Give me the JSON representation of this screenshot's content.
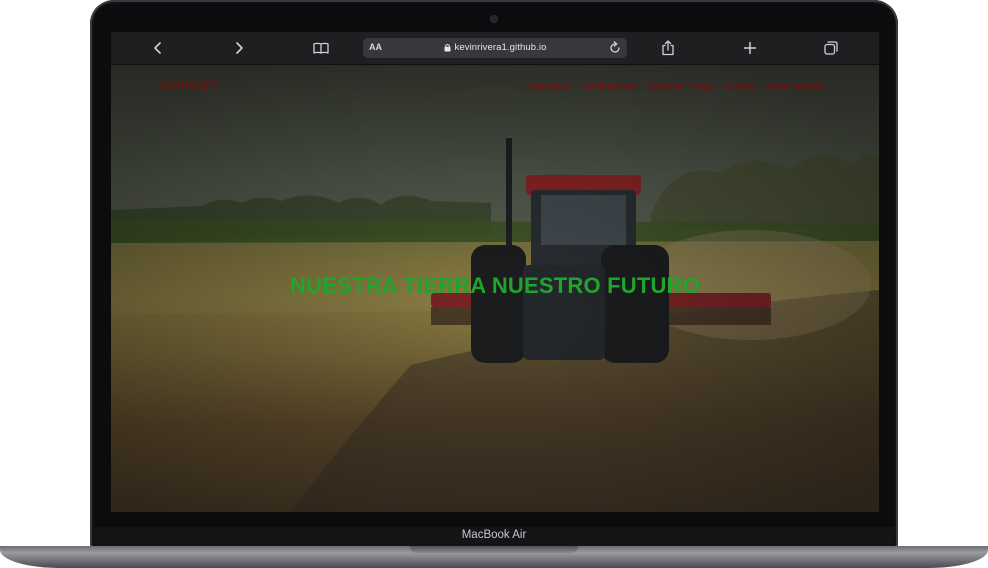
{
  "device": {
    "model_label": "MacBook Air"
  },
  "browser": {
    "reader_label": "AA",
    "url": "kevinrivera1.github.io",
    "icons": [
      "chevron-left-icon",
      "chevron-right-icon",
      "book-icon",
      "lock-icon",
      "reload-icon",
      "share-icon",
      "plus-icon",
      "tabs-icon"
    ]
  },
  "site": {
    "brand": "AGRISOFT",
    "nav": [
      {
        "label": "Reportes"
      },
      {
        "label": "Fertilizantes"
      },
      {
        "label": "Reportar Plaga"
      },
      {
        "label": "Idioma"
      },
      {
        "label": "Iniciar sesión"
      }
    ],
    "headline": "NUESTRA TIERRA NUESTRO FUTURO",
    "colors": {
      "brand": "#6a1414",
      "headline": "#1fa52b"
    }
  }
}
